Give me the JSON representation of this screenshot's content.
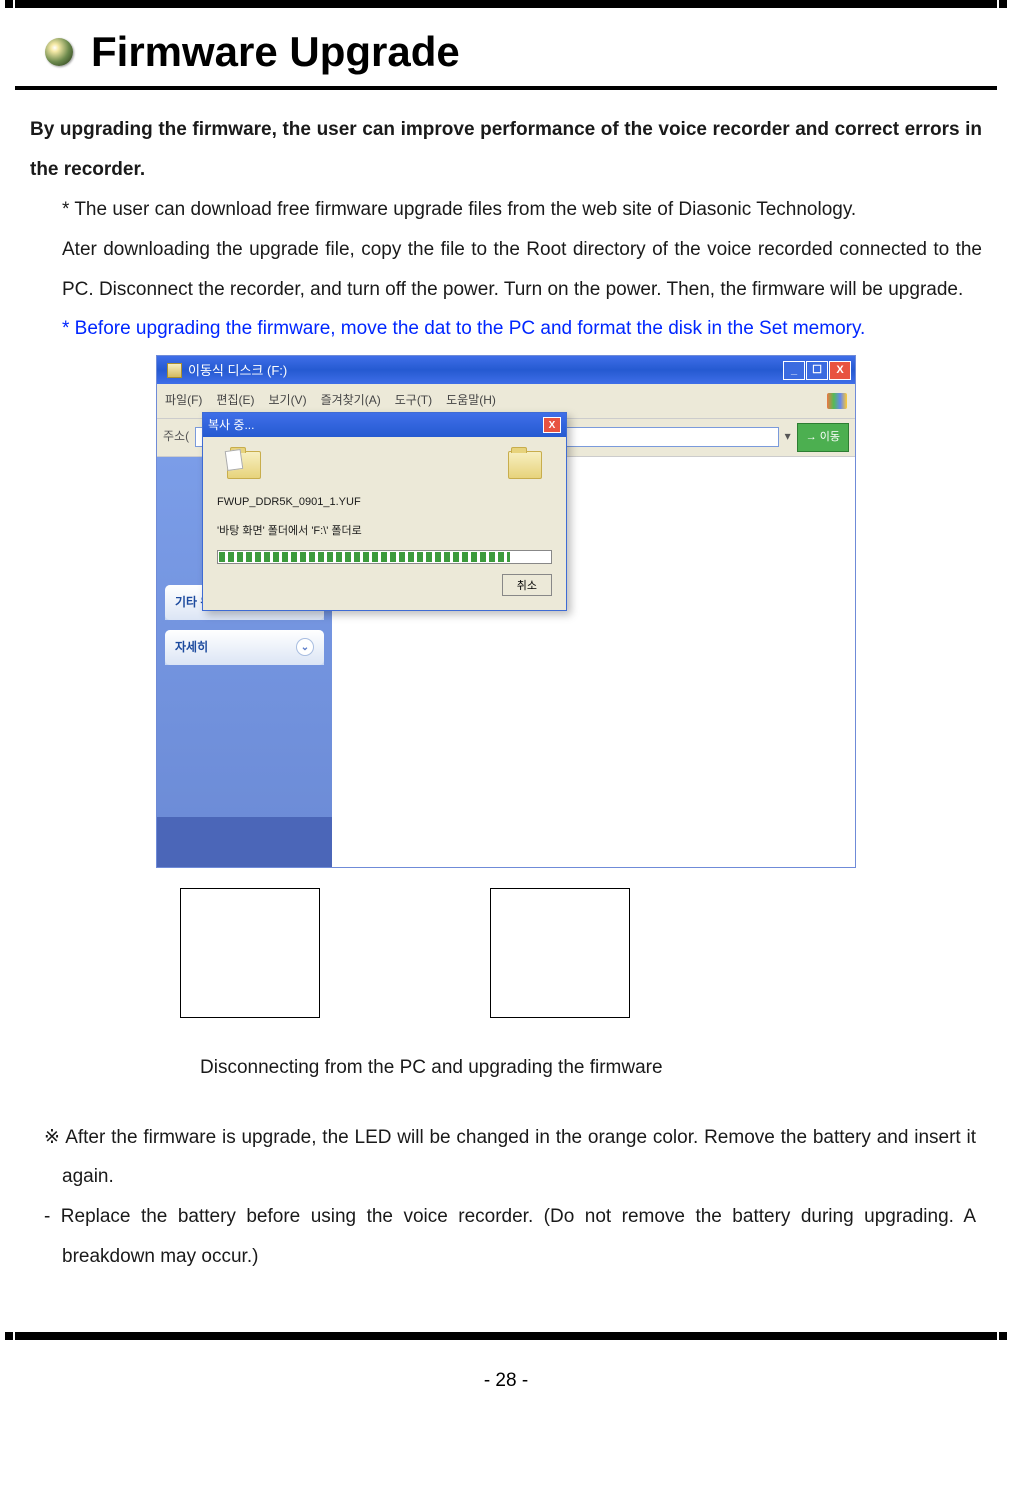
{
  "header": {
    "title": "Firmware Upgrade"
  },
  "body": {
    "intro": "By upgrading the firmware, the user can improve performance of the voice recorder and correct errors in the recorder.",
    "point1": "* The user can download free firmware upgrade files from the web site of Diasonic Technology.",
    "point2": "Ater downloading the upgrade file, copy the file to the Root directory of the voice recorded connected to the PC.   Disconnect the recorder, and turn off the power.   Turn on the power.   Then, the firmware will be upgrade.",
    "blue_note": "* Before upgrading the firmware, move the dat to the PC and format the disk in the Set memory."
  },
  "window": {
    "title": "이동식 디스크 (F:)",
    "menu": {
      "file": "파일(F)",
      "edit": "편집(E)",
      "view": "보기(V)",
      "fav": "즐겨찾기(A)",
      "tools": "도구(T)",
      "help": "도움말(H)"
    },
    "address_label": "주소(",
    "go": "이동",
    "sidebar": {
      "group2": "기타 위치",
      "group3": "자세히"
    },
    "dialog": {
      "title": "복사 중...",
      "filename": "FWUP_DDR5K_0901_1.YUF",
      "pathline": "'바탕 화면' 폴더에서 'F:\\' 폴더로",
      "cancel": "취소"
    }
  },
  "caption": "Disconnecting from the PC and upgrading the firmware",
  "notes": {
    "afterline": "※ After the firmware is upgrade, the LED will be changed in the orange color.   Remove the battery and insert it again.",
    "replaceline": "- Replace the battery before using the voice recorder.   (Do not remove the battery during upgrading. A breakdown may occur.)"
  },
  "pagenum": "- 28 -"
}
